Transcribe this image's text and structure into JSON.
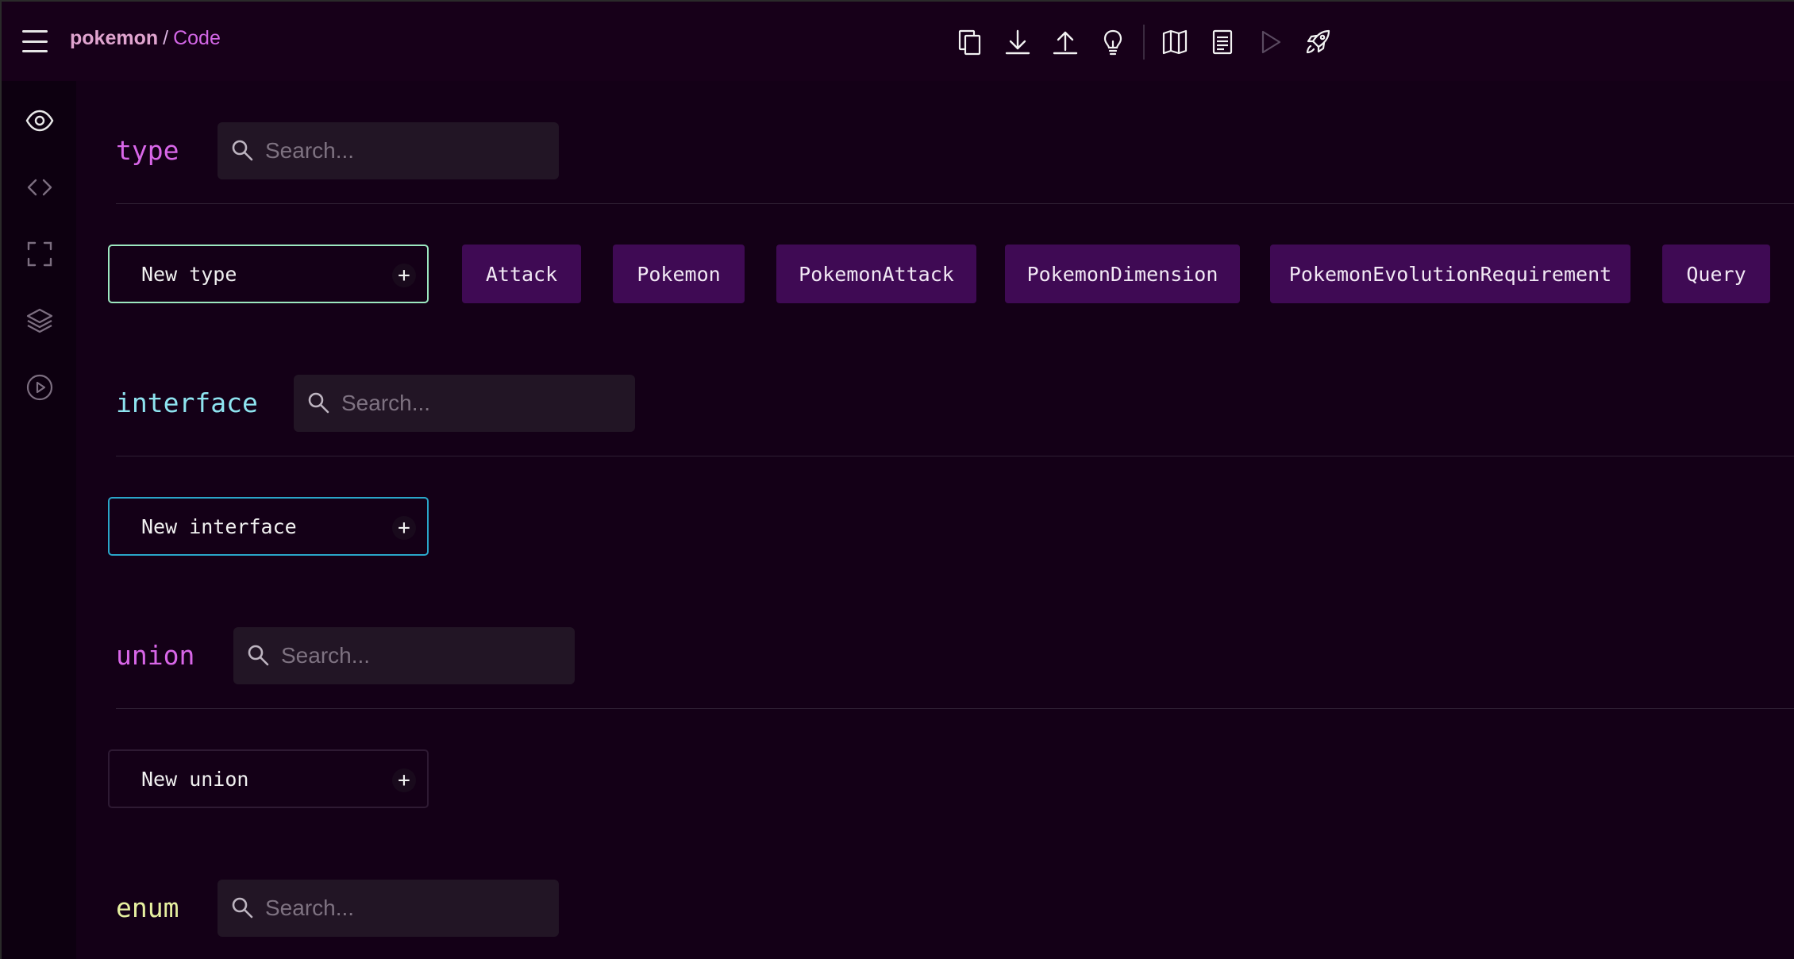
{
  "header": {
    "project": "pokemon",
    "separator": "/",
    "page": "Code"
  },
  "toolbar": {
    "icons": [
      "copy-icon",
      "download-icon",
      "upload-icon",
      "lightbulb-icon",
      "book-icon",
      "document-icon",
      "play-icon",
      "rocket-icon"
    ]
  },
  "rail": {
    "icons": [
      "eye-icon",
      "code-icon",
      "fullscreen-icon",
      "layers-icon",
      "play-circle-icon"
    ]
  },
  "sections": {
    "type": {
      "title": "type",
      "color": "#d866e8",
      "search_placeholder": "Search...",
      "new_label": "New type",
      "border_color": "#9ce8c0",
      "items": [
        "Attack",
        "Pokemon",
        "PokemonAttack",
        "PokemonDimension",
        "PokemonEvolutionRequirement",
        "Query"
      ]
    },
    "interface": {
      "title": "interface",
      "color": "#8ee4f0",
      "search_placeholder": "Search...",
      "new_label": "New interface",
      "border_color": "#2aa6c9"
    },
    "union": {
      "title": "union",
      "color": "#d866e8",
      "search_placeholder": "Search...",
      "new_label": "New union",
      "border_color": "#2e1a33"
    },
    "enum": {
      "title": "enum",
      "color": "#e6f0a0",
      "search_placeholder": "Search..."
    }
  }
}
